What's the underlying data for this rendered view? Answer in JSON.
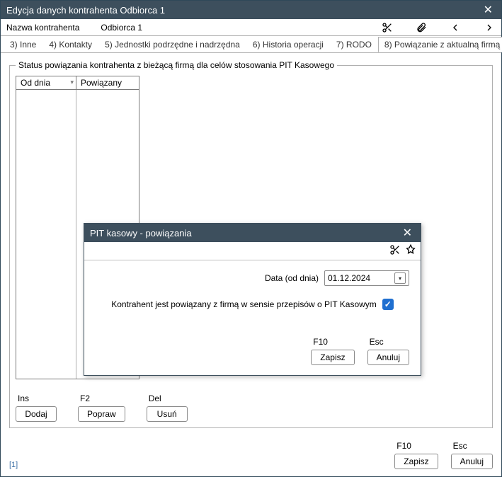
{
  "window": {
    "title": "Edycja danych kontrahenta Odbiorca 1"
  },
  "subheader": {
    "label": "Nazwa kontrahenta",
    "value": "Odbiorca 1"
  },
  "tabs": [
    {
      "label": "3) Inne"
    },
    {
      "label": "4) Kontakty"
    },
    {
      "label": "5) Jednostki podrzędne i nadrzędna"
    },
    {
      "label": "6) Historia operacji"
    },
    {
      "label": "7) RODO"
    },
    {
      "label": "8) Powiązanie z aktualną firmą"
    }
  ],
  "fieldset": {
    "legend": "Status powiązania kontrahenta z bieżącą firmą dla celów stosowania PIT Kasowego",
    "columns": [
      "Od dnia",
      "Powiązany"
    ]
  },
  "fieldset_actions": {
    "ins": {
      "shortcut": "Ins",
      "label": "Dodaj"
    },
    "f2": {
      "shortcut": "F2",
      "label": "Popraw"
    },
    "del": {
      "shortcut": "Del",
      "label": "Usuń"
    }
  },
  "footer": {
    "counter": "[1]",
    "save": {
      "shortcut": "F10",
      "label": "Zapisz"
    },
    "cancel": {
      "shortcut": "Esc",
      "label": "Anuluj"
    }
  },
  "modal": {
    "title": "PIT kasowy - powiązania",
    "date_label": "Data (od dnia)",
    "date_value": "01.12.2024",
    "checkbox_label": "Kontrahent jest powiązany z firmą w sensie przepisów o PIT Kasowym",
    "checkbox_checked": true,
    "save": {
      "shortcut": "F10",
      "label": "Zapisz"
    },
    "cancel": {
      "shortcut": "Esc",
      "label": "Anuluj"
    }
  }
}
